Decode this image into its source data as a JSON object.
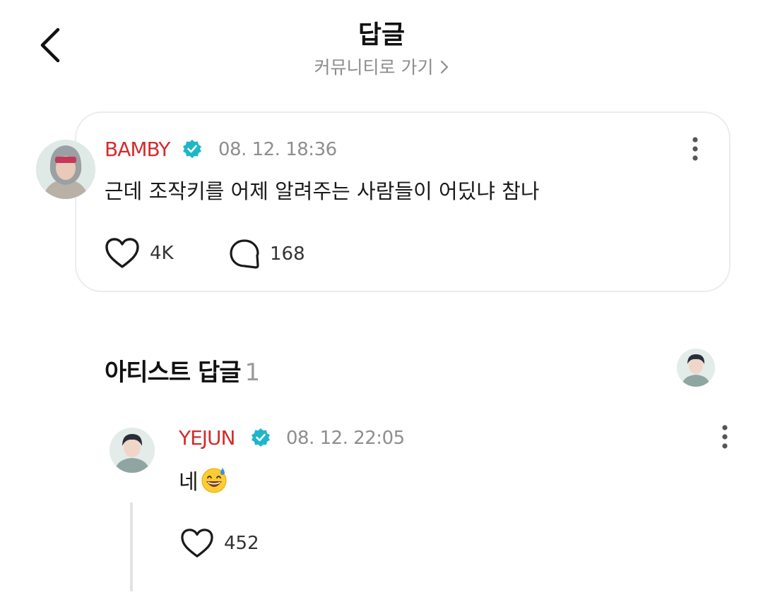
{
  "header": {
    "title": "답글",
    "community_link": "커뮤니티로 가기"
  },
  "post": {
    "author": "BAMBY",
    "timestamp": "08. 12. 18:36",
    "body": "근데 조작키를 어제 알려주는 사람들이 어딨냐 참나",
    "likes": "4K",
    "comments": "168"
  },
  "artist_replies": {
    "label": "아티스트 답글",
    "count": "1"
  },
  "reply": {
    "author": "YEJUN",
    "timestamp": "08. 12. 22:05",
    "body": "네",
    "emoji": "grinning-sweat-emoji",
    "likes": "452"
  },
  "colors": {
    "author_name": "#d32d2d",
    "verified_badge": "#1fb6c9",
    "muted_text": "#8e8e8e",
    "card_border": "#ececec"
  },
  "icons": [
    "back-chevron-icon",
    "chevron-right-icon",
    "verified-badge-icon",
    "more-vertical-icon",
    "heart-icon",
    "comment-bubble-icon"
  ]
}
